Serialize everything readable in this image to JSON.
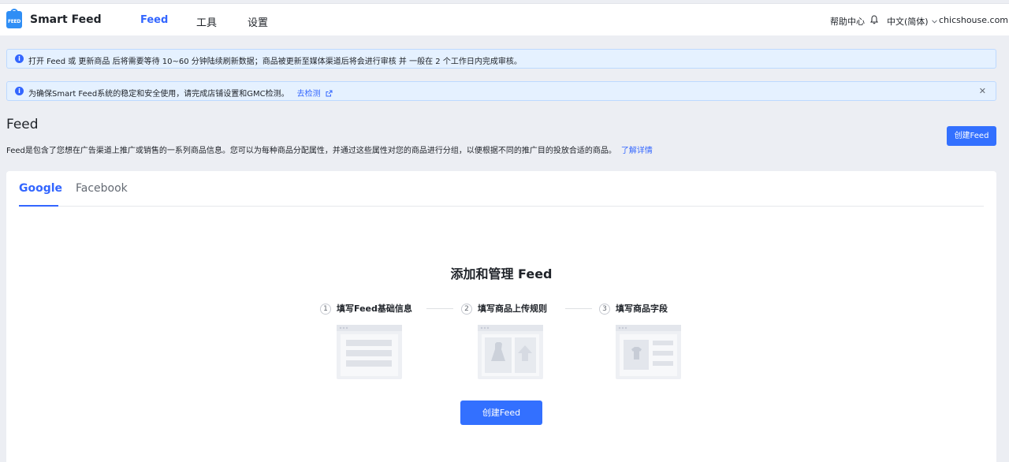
{
  "header": {
    "logo_text": "FEED",
    "app_title": "Smart Feed",
    "nav": [
      {
        "label": "Feed",
        "active": true
      },
      {
        "label": "工具",
        "active": false
      },
      {
        "label": "设置",
        "active": false
      }
    ],
    "help": "帮助中心",
    "language": "中文(简体)",
    "store": "chicshouse.com"
  },
  "alerts": [
    {
      "text": "打开 Feed 或 更新商品 后将需要等待 10~60 分钟陆续刷新数据；商品被更新至媒体渠道后将会进行审核 并 一般在 2 个工作日内完成审核。"
    },
    {
      "text": "为确保Smart Feed系统的稳定和安全使用，请完成店铺设置和GMC检测。",
      "link": "去检测",
      "closable": true
    }
  ],
  "page": {
    "title": "Feed",
    "description": "Feed是包含了您想在广告渠道上推广或销售的一系列商品信息。您可以为每种商品分配属性，并通过这些属性对您的商品进行分组，以便根据不同的推广目的投放合适的商品。",
    "more_link": "了解详情",
    "create_button": "创建Feed"
  },
  "tabs": [
    {
      "label": "Google",
      "active": true
    },
    {
      "label": "Facebook",
      "active": false
    }
  ],
  "empty_state": {
    "title": "添加和管理 Feed",
    "steps": [
      {
        "num": "1",
        "label": "填写Feed基础信息"
      },
      {
        "num": "2",
        "label": "填写商品上传规则"
      },
      {
        "num": "3",
        "label": "填写商品字段"
      }
    ],
    "create_button": "创建Feed"
  },
  "colors": {
    "primary": "#3370ff",
    "alert_bg": "#e5f1ff",
    "page_bg": "#eceef3"
  }
}
